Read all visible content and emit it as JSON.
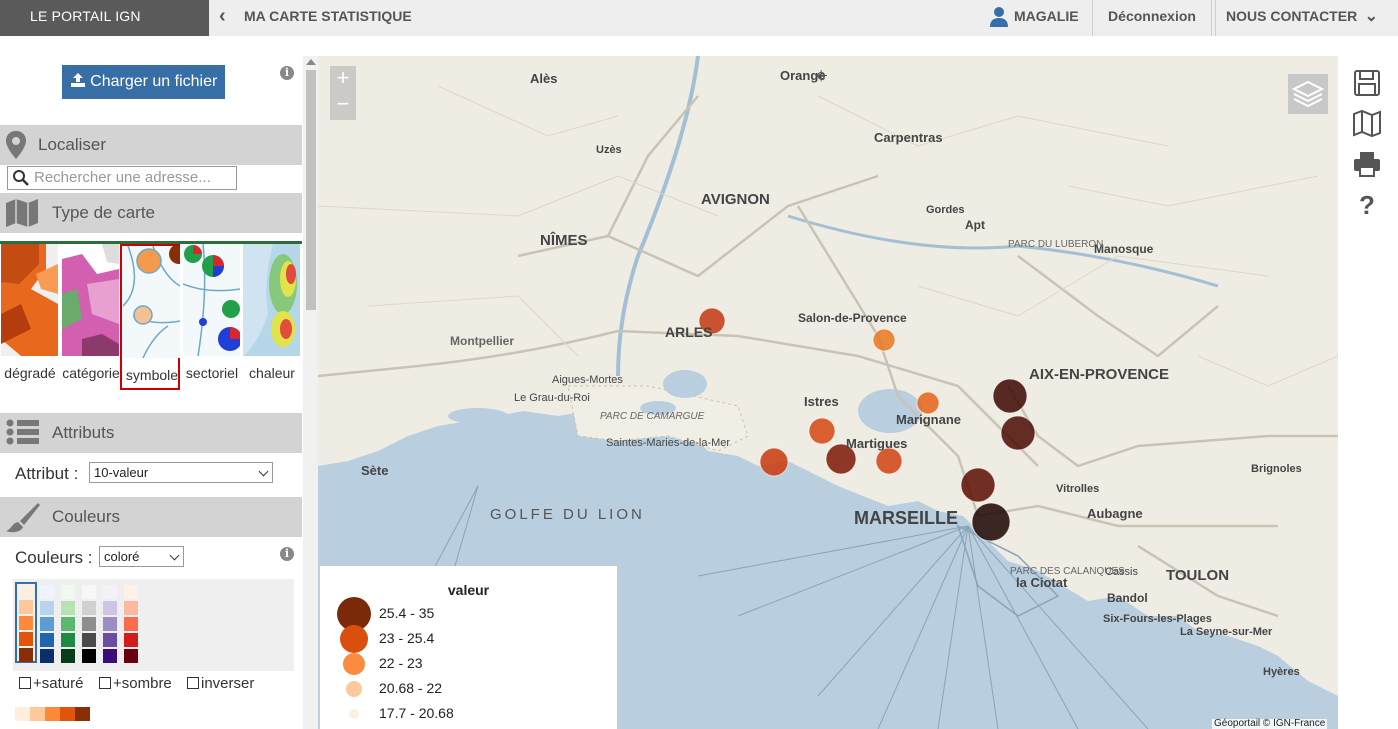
{
  "topbar": {
    "brand": "LE PORTAIL IGN",
    "page_title": "MA CARTE STATISTIQUE",
    "user": "MAGALIE",
    "logout": "Déconnexion",
    "contact": "NOUS CONTACTER"
  },
  "sidebar": {
    "upload_label": "Charger un fichier",
    "localiser": {
      "title": "Localiser",
      "search_placeholder": "Rechercher une adresse..."
    },
    "type_carte": {
      "title": "Type de carte",
      "types": [
        {
          "label": "dégradé"
        },
        {
          "label": "catégorie"
        },
        {
          "label": "symbole",
          "selected": true
        },
        {
          "label": "sectoriel"
        },
        {
          "label": "chaleur"
        }
      ]
    },
    "attributs": {
      "title": "Attributs",
      "attr_label": "Attribut :",
      "attr_value": "10-valeur"
    },
    "couleurs": {
      "title": "Couleurs",
      "colors_label": "Couleurs :",
      "colors_value": "coloré",
      "palettes": [
        [
          "#feeee0",
          "#fdc99a",
          "#fd8a3b",
          "#e0550c",
          "#8a2e08"
        ],
        [
          "#eef4fb",
          "#b8d4ec",
          "#5b9cd3",
          "#2166ac",
          "#0b2f6b"
        ],
        [
          "#effaf0",
          "#b7e2b4",
          "#5cb86b",
          "#1f8a43",
          "#063d1d"
        ],
        [
          "#f7f7f7",
          "#d0d0d0",
          "#8e8e8e",
          "#4a4a4a",
          "#000000"
        ],
        [
          "#f4f1f8",
          "#cdc5e3",
          "#9a8dc5",
          "#6b4ea3",
          "#3b0d7a"
        ],
        [
          "#fef1ea",
          "#fcb9a0",
          "#f86b4d",
          "#d21d1d",
          "#6b0010"
        ]
      ],
      "saturated": "+saturé",
      "darker": "+sombre",
      "invert": "inverser",
      "preview": [
        "#feeee0",
        "#fdc99a",
        "#fd8a3b",
        "#e0550c",
        "#8a2e08"
      ]
    }
  },
  "map": {
    "zoom_in": "+",
    "zoom_out": "−",
    "labels": [
      "GOLFE DU LION",
      "MARSEILLE",
      "AVIGNON",
      "NÎMES",
      "ARLES",
      "AIX-EN-PROVENCE",
      "TOULON",
      "Carpentras",
      "Istres",
      "Martigues",
      "Marignane",
      "Salon-de-Provence",
      "Sète",
      "Aubagne",
      "la Ciotat",
      "Cassis",
      "Bandol",
      "Alès",
      "Apt",
      "Manosque",
      "Saintes-Maries-de-la-Mer",
      "Orange",
      "Uzès",
      "Gordes",
      "Vitrolles",
      "Brignoles",
      "Hyères",
      "La Seyne-sur-Mer",
      "PARC DE CAMARGUE",
      "PARC DU LUBERON",
      "PARC DES CALANQUES",
      "Montpellier",
      "Aigues-Mortes",
      "Le Grau-du-Roi",
      "Six-Fours-les-Plages"
    ],
    "attribution": "Géoportail © IGN-France"
  },
  "legend": {
    "title": "valeur",
    "classes": [
      {
        "range": "25.4 - 35",
        "color": "#7a2a08"
      },
      {
        "range": "23 - 25.4",
        "color": "#db4f0e"
      },
      {
        "range": "22 - 23",
        "color": "#fb8b3e"
      },
      {
        "range": "20.68 - 22",
        "color": "#fcc89c"
      },
      {
        "range": "17.7 - 20.68",
        "color": "#fdefe1"
      }
    ]
  },
  "symbols": [
    {
      "color": "#c2380f"
    },
    {
      "color": "#e9781d"
    },
    {
      "color": "#e5621a"
    },
    {
      "color": "#3d0700"
    },
    {
      "color": "#4a0a02"
    },
    {
      "color": "#c9380c"
    },
    {
      "color": "#7d1704"
    },
    {
      "color": "#d54710"
    },
    {
      "color": "#d24210"
    },
    {
      "color": "#5a0e02"
    },
    {
      "color": "#1c0400"
    }
  ]
}
